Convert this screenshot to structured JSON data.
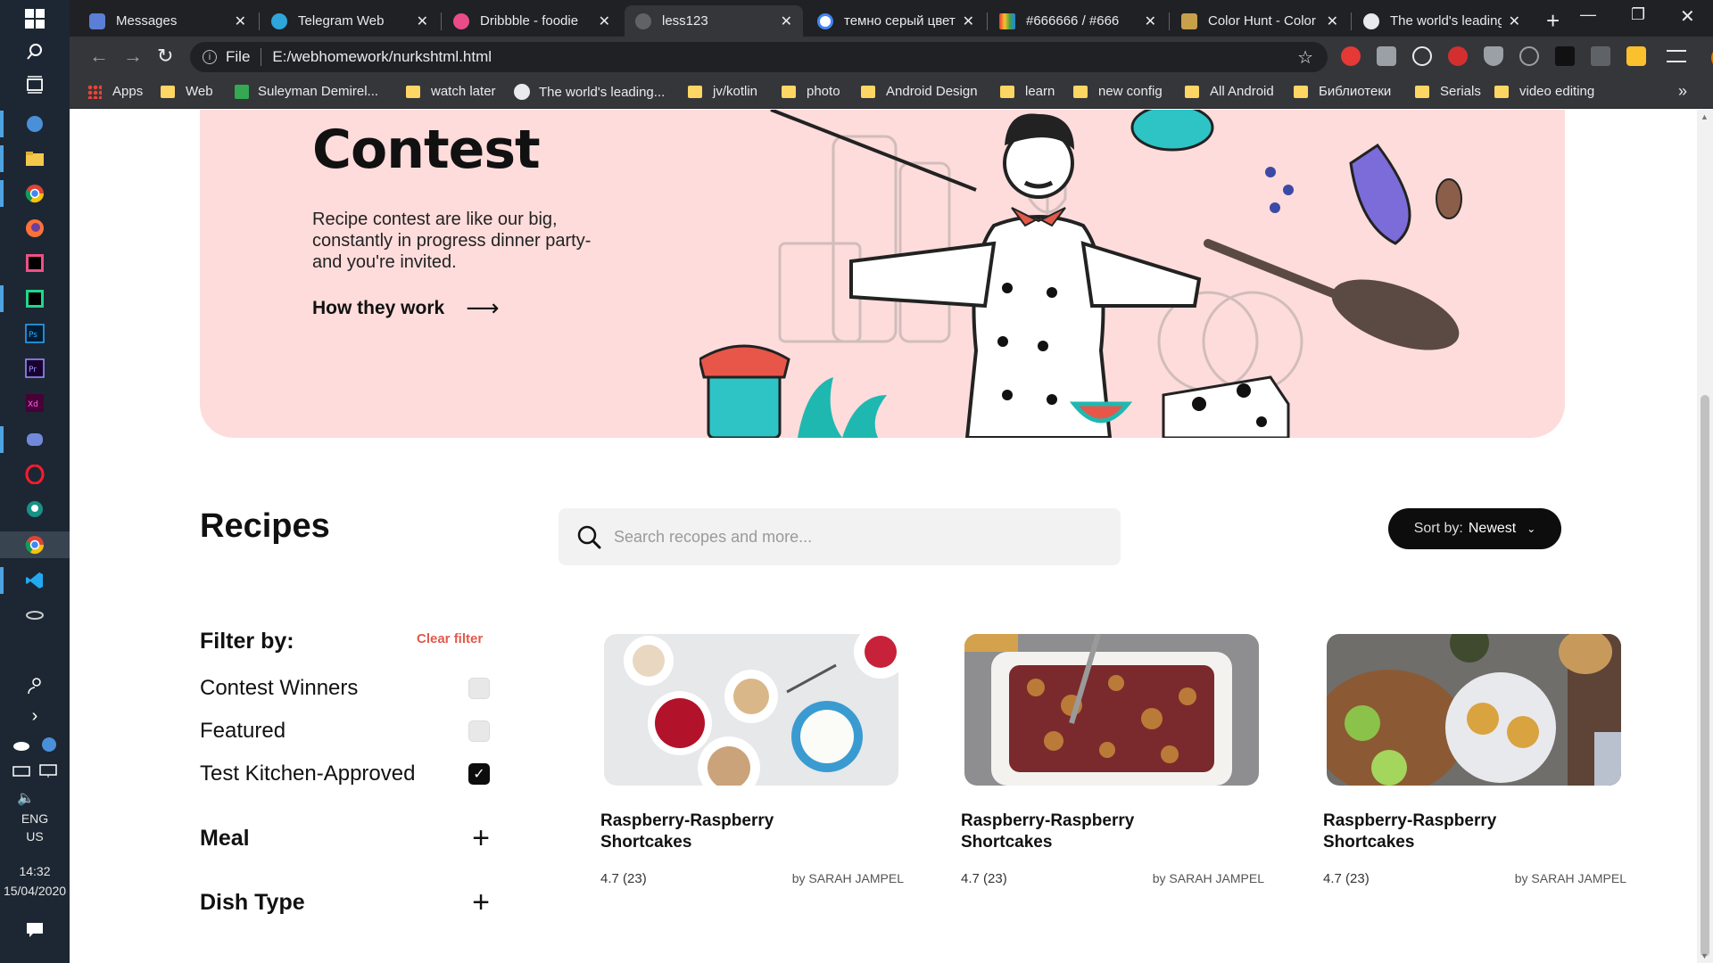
{
  "taskbar": {
    "language": "ENG",
    "region": "US",
    "time": "14:32",
    "date": "15/04/2020"
  },
  "browser": {
    "tabs": [
      {
        "title": "Messages",
        "color": "#5b7fd6",
        "active": false
      },
      {
        "title": "Telegram Web",
        "color": "#2ea6da",
        "active": false
      },
      {
        "title": "Dribbble - foodie",
        "color": "#ea4c89",
        "active": false
      },
      {
        "title": "less123",
        "color": "#5f6368",
        "active": true
      },
      {
        "title": "темно серый цвет",
        "color": "#ffffff",
        "active": false
      },
      {
        "title": "#666666 / #666",
        "color": "#e0b43a",
        "active": false
      },
      {
        "title": "Color Hunt - Color",
        "color": "#c8a04a",
        "active": false
      },
      {
        "title": "The world's leading",
        "color": "#e8eaed",
        "active": false
      }
    ],
    "url_scheme": "File",
    "url": "E:/webhomework/nurkshtml.html",
    "profile_initial": "N",
    "bookmarks": [
      "Apps",
      "Web",
      "Suleyman Demirel...",
      "watch later",
      "The world's leading...",
      "jv/kotlin",
      "photo",
      "Android Design",
      "learn",
      "new config",
      "All Android",
      "Библиотеки",
      "Serials",
      "video editing"
    ]
  },
  "hero": {
    "title": "Contest",
    "description": "Recipe contest are like our big, constantly in progress dinner party-and you're invited.",
    "link_label": "How they work",
    "background": "#fddcdb"
  },
  "recipes": {
    "title": "Recipes",
    "search_placeholder": "Search recopes and more...",
    "sort_label": "Sort by:",
    "sort_value": "Newest"
  },
  "filters": {
    "heading": "Filter by:",
    "clear_label": "Clear filter",
    "options": [
      {
        "label": "Contest Winners",
        "checked": false
      },
      {
        "label": "Featured",
        "checked": false
      },
      {
        "label": "Test Kitchen-Approved",
        "checked": true
      }
    ],
    "groups": [
      {
        "label": "Meal"
      },
      {
        "label": "Dish Type"
      }
    ]
  },
  "cards": [
    {
      "title": "Raspberry-Raspberry Shortcakes",
      "rating": "4.7 (23)",
      "author": "by SARAH JAMPEL"
    },
    {
      "title": "Raspberry-Raspberry Shortcakes",
      "rating": "4.7 (23)",
      "author": "by SARAH JAMPEL"
    },
    {
      "title": "Raspberry-Raspberry Shortcakes",
      "rating": "4.7 (23)",
      "author": "by SARAH JAMPEL"
    }
  ],
  "colors": {
    "accent": "#e05a4e",
    "dark": "#0d0d0d"
  }
}
